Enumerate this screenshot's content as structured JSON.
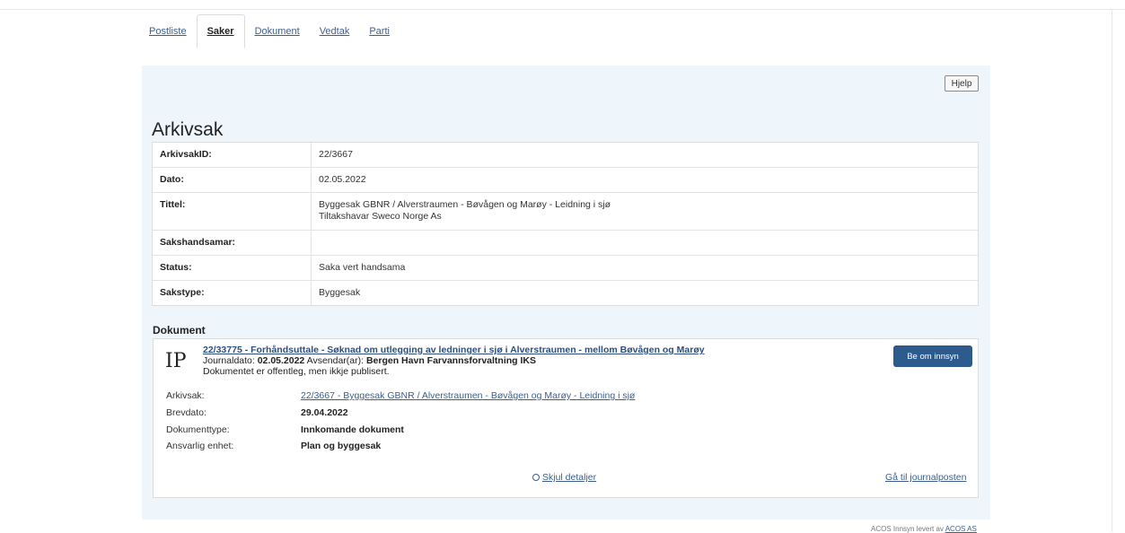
{
  "tabs": [
    {
      "label": "Postliste",
      "active": false
    },
    {
      "label": "Saker",
      "active": true
    },
    {
      "label": "Dokument",
      "active": false
    },
    {
      "label": "Vedtak",
      "active": false
    },
    {
      "label": "Parti",
      "active": false
    }
  ],
  "help_label": "Hjelp",
  "page_title": "Arkivsak",
  "case": {
    "rows": [
      {
        "label": "ArkivsakID:",
        "value": "22/3667"
      },
      {
        "label": "Dato:",
        "value": "02.05.2022"
      },
      {
        "label": "Tittel:",
        "value": "Byggesak GBNR / Alverstraumen - Bøvågen og Marøy - Leidning i sjø",
        "value2": "Tiltakshavar Sweco Norge As"
      },
      {
        "label": "Sakshandsamar:",
        "value": ""
      },
      {
        "label": "Status:",
        "value": "Saka vert handsama"
      },
      {
        "label": "Sakstype:",
        "value": "Byggesak"
      }
    ]
  },
  "documents_title": "Dokument",
  "document": {
    "type_code": "IP",
    "title_link": "22/33775 - Forhåndsuttale - Søknad om utlegging av ledninger i sjø i Alverstraumen - mellom Bøvågen og Marøy",
    "journaldato_label": "Journaldato:",
    "journaldato": "02.05.2022",
    "avsendar_label": "Avsendar(ar):",
    "avsendar": "Bergen Havn Farvannsforvaltning IKS",
    "notice": "Dokumentet er offentleg, men ikkje publisert.",
    "request_button": "Be om innsyn",
    "details": {
      "arkivsak_label": "Arkivsak:",
      "arkivsak_value": "22/3667 - Byggesak GBNR / Alverstraumen - Bøvågen og Marøy - Leidning i sjø",
      "brevdato_label": "Brevdato:",
      "brevdato_value": "29.04.2022",
      "dokumenttype_label": "Dokumenttype:",
      "dokumenttype_value": "Innkomande dokument",
      "ansvarlig_label": "Ansvarlig enhet:",
      "ansvarlig_value": "Plan og byggesak"
    },
    "hide_details": "Skjul detaljer",
    "goto_journal": "Gå til journalposten"
  },
  "footer": {
    "text": "ACOS Innsyn levert av",
    "link": "ACOS AS"
  }
}
